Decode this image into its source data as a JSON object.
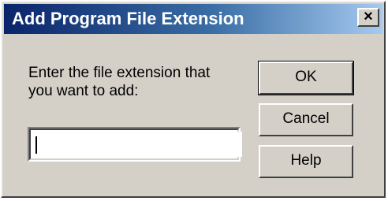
{
  "window": {
    "title": "Add Program File Extension",
    "close_glyph": "×"
  },
  "prompt": {
    "line1": "Enter the file extension that",
    "line2": "you want to add:"
  },
  "extension_field": {
    "value": "",
    "placeholder": ""
  },
  "buttons": {
    "ok": "OK",
    "cancel": "Cancel",
    "help": "Help"
  },
  "colors": {
    "titlebar_start": "#0a246a",
    "titlebar_end": "#a6caf0",
    "face": "#d4d0c8"
  }
}
